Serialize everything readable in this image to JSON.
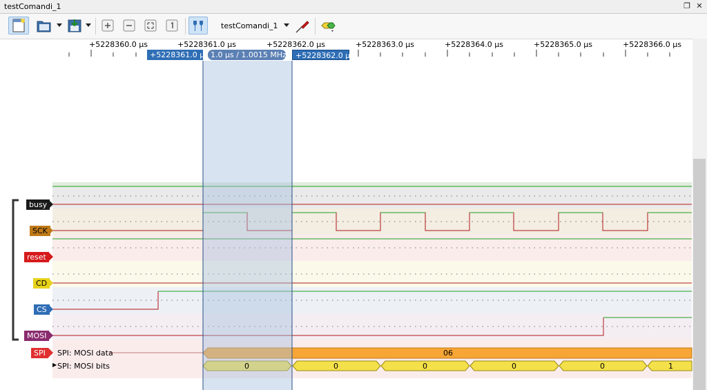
{
  "window": {
    "title": "testComandi_1"
  },
  "toolbar": {
    "session_name": "testComandi_1"
  },
  "ruler": {
    "ticks": [
      "+5228360.0 µs",
      "+5228361.0 µs",
      "+5228362.0 µs",
      "+5228363.0 µs",
      "+5228364.0 µs",
      "+5228365.0 µs",
      "+5228366.0 µs"
    ]
  },
  "cursors": {
    "left": "+5228361.0 µs",
    "delta": "1.0 µs / 1.0015 MHz",
    "right": "+5228362.0 µs"
  },
  "channels": [
    {
      "label": "busy",
      "color": "#1a1a1a",
      "text_color": "#ffffff"
    },
    {
      "label": "SCK",
      "color": "#c07a18",
      "text_color": "#000000"
    },
    {
      "label": "reset",
      "color": "#d61a1a",
      "text_color": "#ffffff"
    },
    {
      "label": "CD",
      "color": "#e8d21a",
      "text_color": "#000000"
    },
    {
      "label": "CS",
      "color": "#2f6eb5",
      "text_color": "#ffffff"
    },
    {
      "label": "MOSI",
      "color": "#8a2b6e",
      "text_color": "#ffffff"
    }
  ],
  "decoder": {
    "tag": "SPI",
    "rows": [
      "SPI: MOSI data",
      "SPI: MOSI bits"
    ],
    "data_value": "06",
    "bits": [
      "0",
      "0",
      "0",
      "0",
      "0",
      "1"
    ]
  },
  "colors": {
    "signal_high": "#21a021",
    "signal_low": "#b01818",
    "selection": "#c7d7ea",
    "data_bar": "#f7a534",
    "bits_bar": "#f4e04a",
    "cursor_tag": "#2f6eb5"
  }
}
